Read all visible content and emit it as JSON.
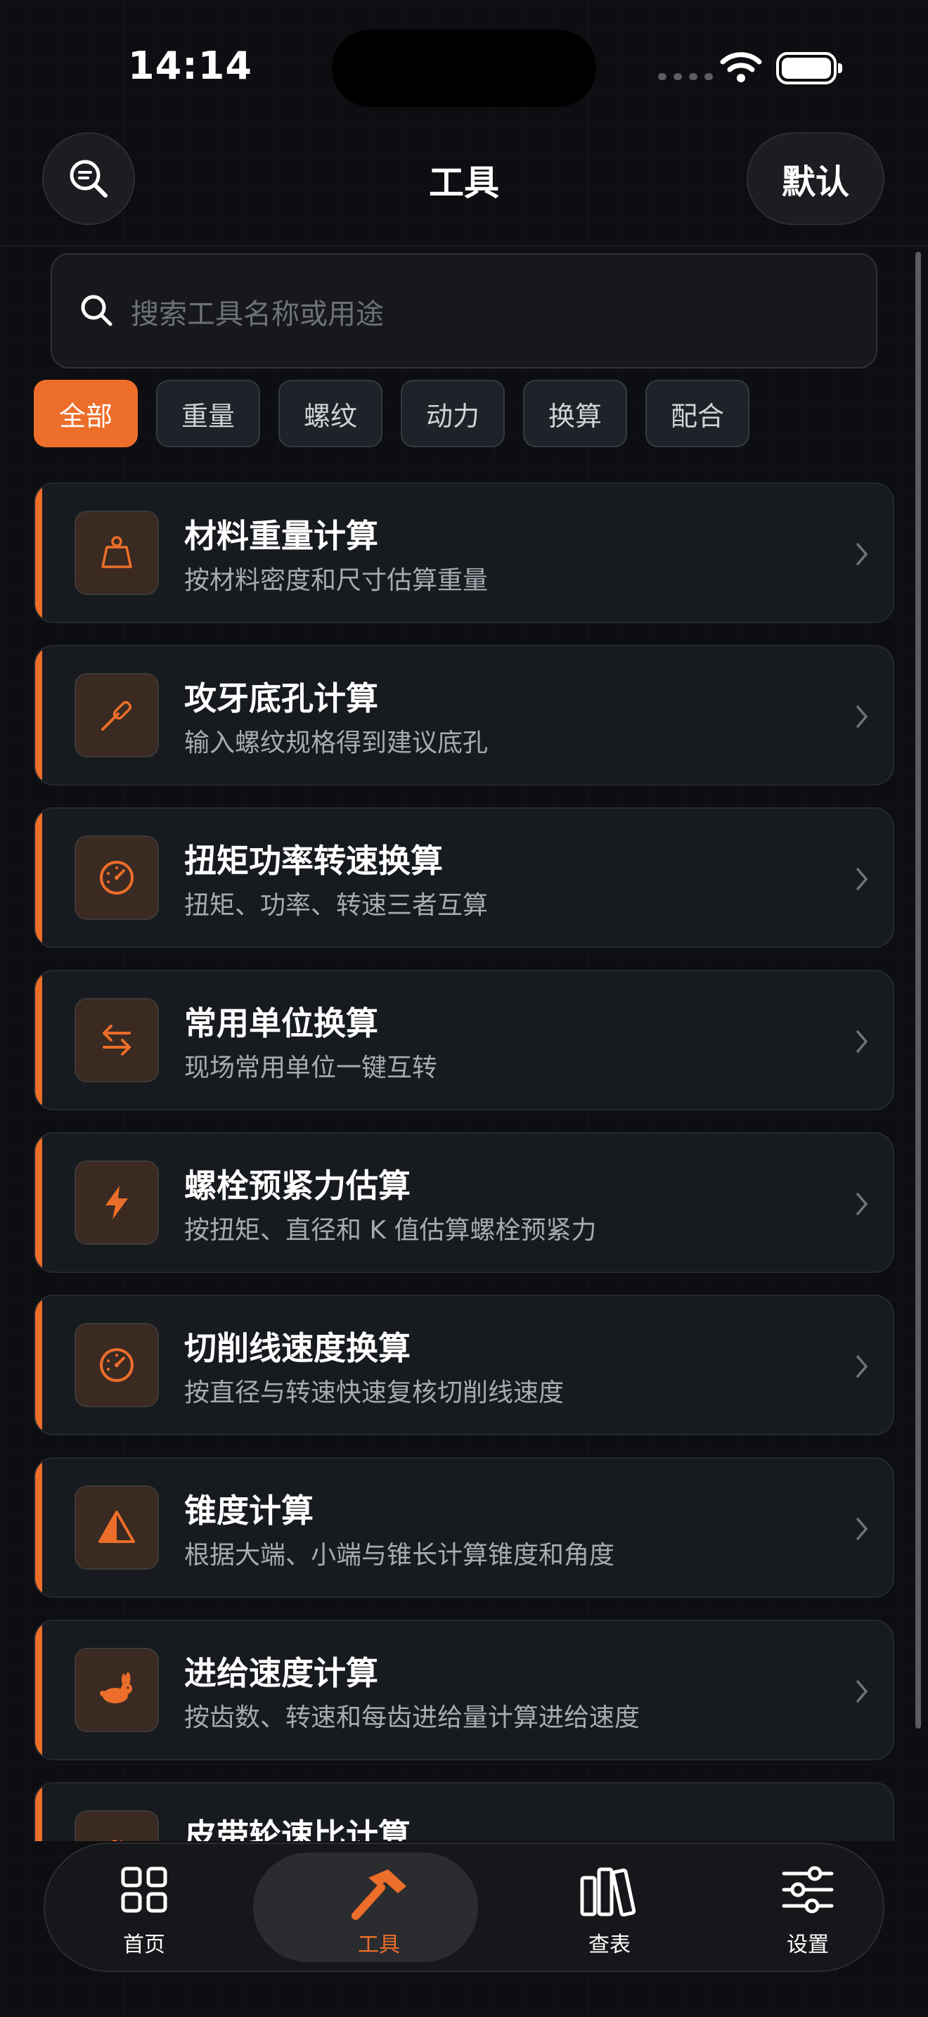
{
  "status_bar": {
    "time": "14:14"
  },
  "nav": {
    "title": "工具",
    "right_button": "默认"
  },
  "search": {
    "placeholder": "搜索工具名称或用途"
  },
  "chips": [
    {
      "label": "全部",
      "active": true
    },
    {
      "label": "重量",
      "active": false
    },
    {
      "label": "螺纹",
      "active": false
    },
    {
      "label": "动力",
      "active": false
    },
    {
      "label": "换算",
      "active": false
    },
    {
      "label": "配合",
      "active": false
    }
  ],
  "tools": [
    {
      "title": "材料重量计算",
      "subtitle": "按材料密度和尺寸估算重量",
      "icon": "weight-icon"
    },
    {
      "title": "攻牙底孔计算",
      "subtitle": "输入螺纹规格得到建议底孔",
      "icon": "screwdriver-icon"
    },
    {
      "title": "扭矩功率转速换算",
      "subtitle": "扭矩、功率、转速三者互算",
      "icon": "gauge-icon"
    },
    {
      "title": "常用单位换算",
      "subtitle": "现场常用单位一键互转",
      "icon": "swap-arrows-icon"
    },
    {
      "title": "螺栓预紧力估算",
      "subtitle": "按扭矩、直径和 K 值估算螺栓预紧力",
      "icon": "bolt-icon"
    },
    {
      "title": "切削线速度换算",
      "subtitle": "按直径与转速快速复核切削线速度",
      "icon": "gauge-icon"
    },
    {
      "title": "锥度计算",
      "subtitle": "根据大端、小端与锥长计算锥度和角度",
      "icon": "triangle-icon"
    },
    {
      "title": "进给速度计算",
      "subtitle": "按齿数、转速和每齿进给量计算进给速度",
      "icon": "rabbit-icon"
    },
    {
      "title": "皮带轮速比计算",
      "subtitle": "",
      "icon": "gear-icon"
    }
  ],
  "tabbar": [
    {
      "label": "首页",
      "icon": "grid-icon",
      "active": false
    },
    {
      "label": "工具",
      "icon": "hammer-icon",
      "active": true
    },
    {
      "label": "查表",
      "icon": "books-icon",
      "active": false
    },
    {
      "label": "设置",
      "icon": "sliders-icon",
      "active": false
    }
  ],
  "colors": {
    "accent": "#ec6e2a",
    "background": "#0d0e11",
    "card": "#171a1f"
  }
}
